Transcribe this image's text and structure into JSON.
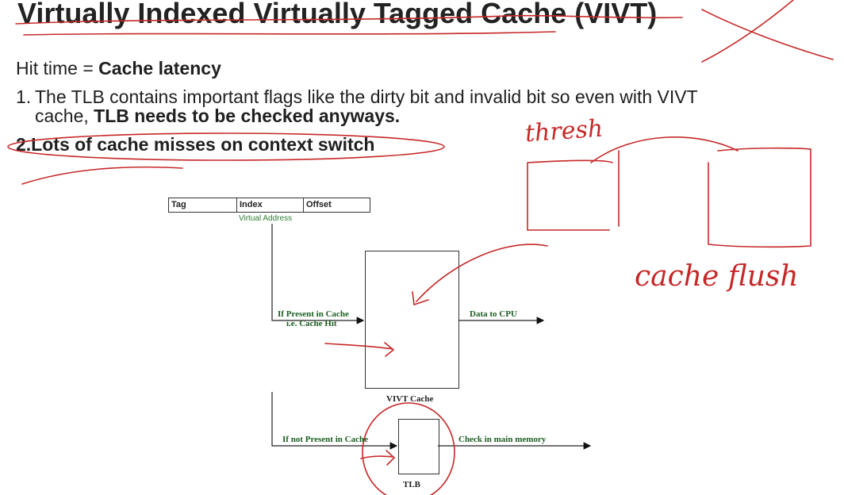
{
  "slide": {
    "title": "Virtually Indexed Virtually Tagged Cache (VIVT)",
    "hit_time_label": "Hit time = ",
    "hit_time_value": "Cache latency",
    "point1_number": "1.",
    "point1_text": "The TLB contains important flags like the dirty bit and invalid bit so even with VIVT",
    "point1_cont_plain": "cache, ",
    "point1_cont_bold": "TLB needs to be checked anyways.",
    "point2": "2.Lots of cache misses on context switch"
  },
  "diagram": {
    "address_fields": [
      "Tag",
      "Index",
      "Offset"
    ],
    "address_caption": "Virtual Address",
    "hit_label_line1": "If Present in Cache",
    "hit_label_line2": "i.e. Cache Hit",
    "data_to_cpu": "Data to CPU",
    "cache_label": "VIVT Cache",
    "miss_label": "If not Present in Cache",
    "check_memory": "Check in main memory",
    "tlb_label": "TLB"
  },
  "annotations": {
    "thresh": "thresh",
    "cache_flush": "cache flush",
    "ink_color": "#c62828"
  }
}
